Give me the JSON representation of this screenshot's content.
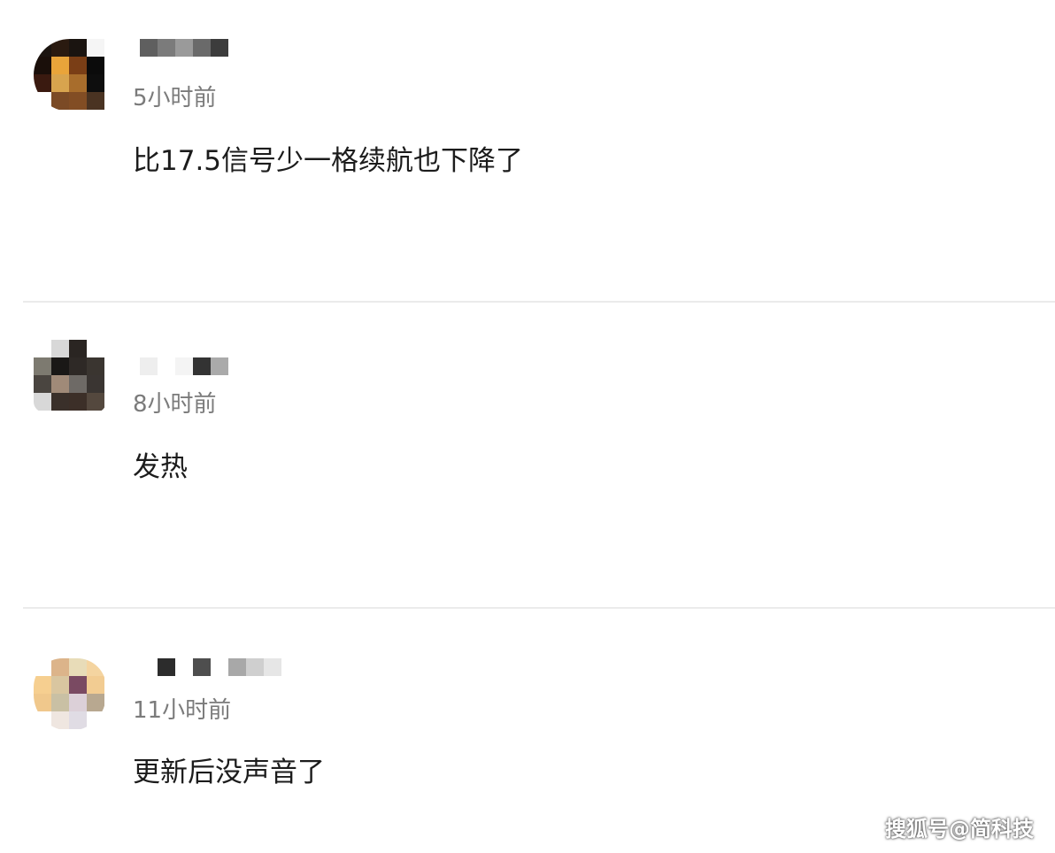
{
  "comments": [
    {
      "time": "5小时前",
      "text": "比17.5信号少一格续航也下降了"
    },
    {
      "time": "8小时前",
      "text": "发热"
    },
    {
      "time": "11小时前",
      "text": "更新后没声音了"
    }
  ],
  "watermark": "搜狐号@简科技"
}
